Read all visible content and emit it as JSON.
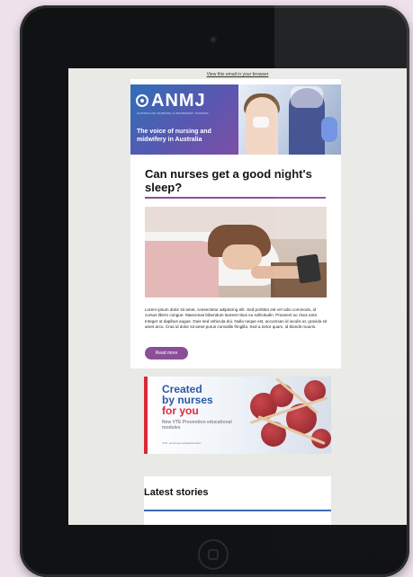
{
  "email": {
    "view_link": "View this email in your browser",
    "brand": {
      "logo": "ANMJ",
      "logo_sub": "AUSTRALIAN NURSING & MIDWIFERY JOURNAL",
      "tagline": "The voice of nursing and midwifery in Australia"
    },
    "article": {
      "headline": "Can nurses get a good night's sleep?",
      "body": "Lorem ipsum dolor sit amet, consectetur adipiscing elit. Sed porttitor est vel odio commodo, id cursus libero congue. Maecenas bibendum laoreet risus eu sollicitudin. Praesent ac risus ante. Integer ut dapibus augue. Duis sed vehicula dui. Nulla neque est, accumsan id iaculis at, gravida sit amet arcu. Cras id dolor sit amet purus convallis fringilla. Sed a tortor quam, id blandit mauris.",
      "read_more": "Read more"
    },
    "ad": {
      "line1": "Created",
      "line2": "by nurses",
      "line3": "for you",
      "subtitle": "New VTE Prevention educational modules",
      "footer": "VTE - anmf.org.au/vteprevention"
    },
    "latest": {
      "title": "Latest stories"
    }
  },
  "colors": {
    "accent_purple": "#8a4f96",
    "brand_blue": "#2b58a8",
    "ad_red": "#d92a3a",
    "latest_rule": "#3d6ab5"
  },
  "icons": [
    "camera-icon",
    "home-button-icon",
    "anmj-logo-icon"
  ]
}
